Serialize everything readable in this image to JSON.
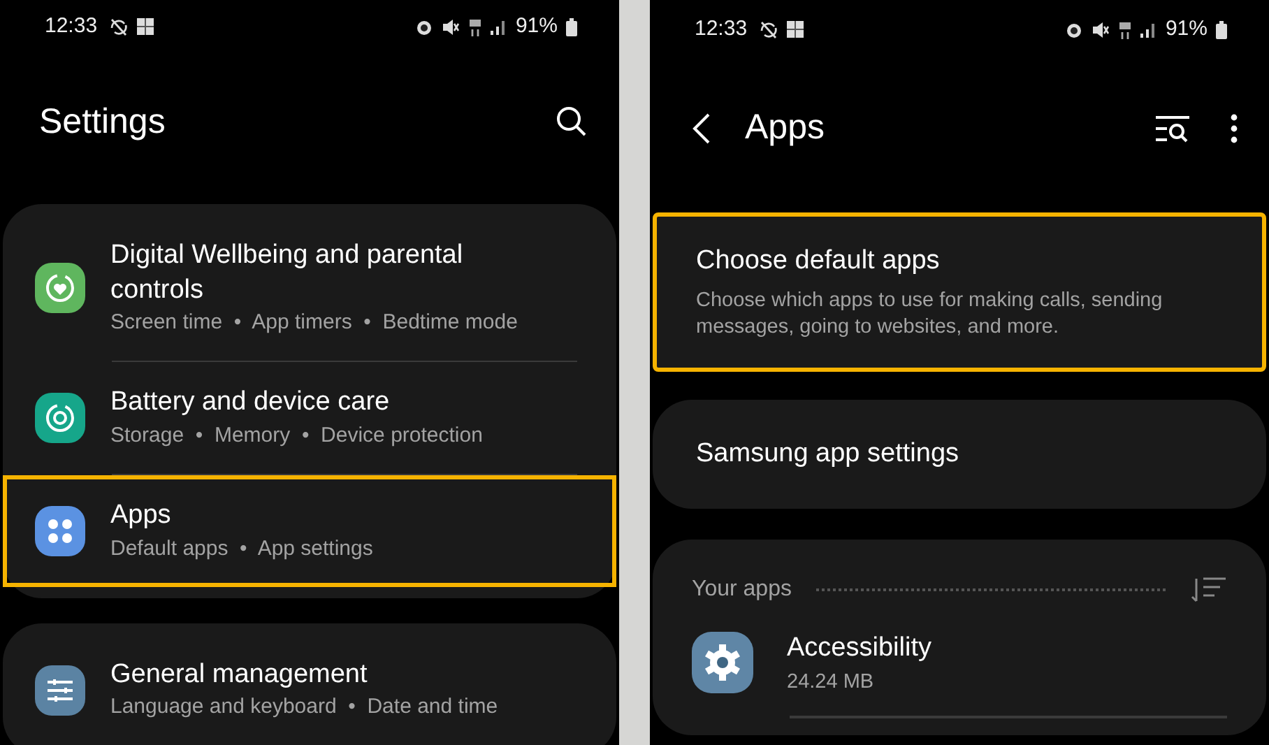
{
  "settings_screen": {
    "status_bar": {
      "time": "12:33",
      "battery": "91%"
    },
    "title": "Settings",
    "groups": [
      [
        {
          "title": "Digital Wellbeing and parental controls",
          "subtitle": "Screen time  •  App timers  •  Bedtime mode",
          "color": "#5fb65e",
          "highlighted": false
        },
        {
          "title": "Battery and device care",
          "subtitle": "Storage  •  Memory  •  Device protection",
          "color": "#16a68a",
          "highlighted": false
        },
        {
          "title": "Apps",
          "subtitle": "Default apps  •  App settings",
          "color": "#5b92e2",
          "highlighted": true
        }
      ],
      [
        {
          "title": "General management",
          "subtitle": "Language and keyboard  •  Date and time",
          "color": "#5b83a3",
          "highlighted": false
        }
      ]
    ]
  },
  "apps_screen": {
    "status_bar": {
      "time": "12:33",
      "battery": "91%"
    },
    "title": "Apps",
    "cards": [
      {
        "title": "Choose default apps",
        "subtitle": "Choose which apps to use for making calls, sending messages, going to websites, and more.",
        "highlighted": true
      },
      {
        "title": "Samsung app settings",
        "highlighted": false
      }
    ],
    "your_apps": {
      "heading": "Your apps",
      "apps": [
        {
          "name": "Accessibility",
          "size": "24.24 MB"
        }
      ]
    }
  }
}
